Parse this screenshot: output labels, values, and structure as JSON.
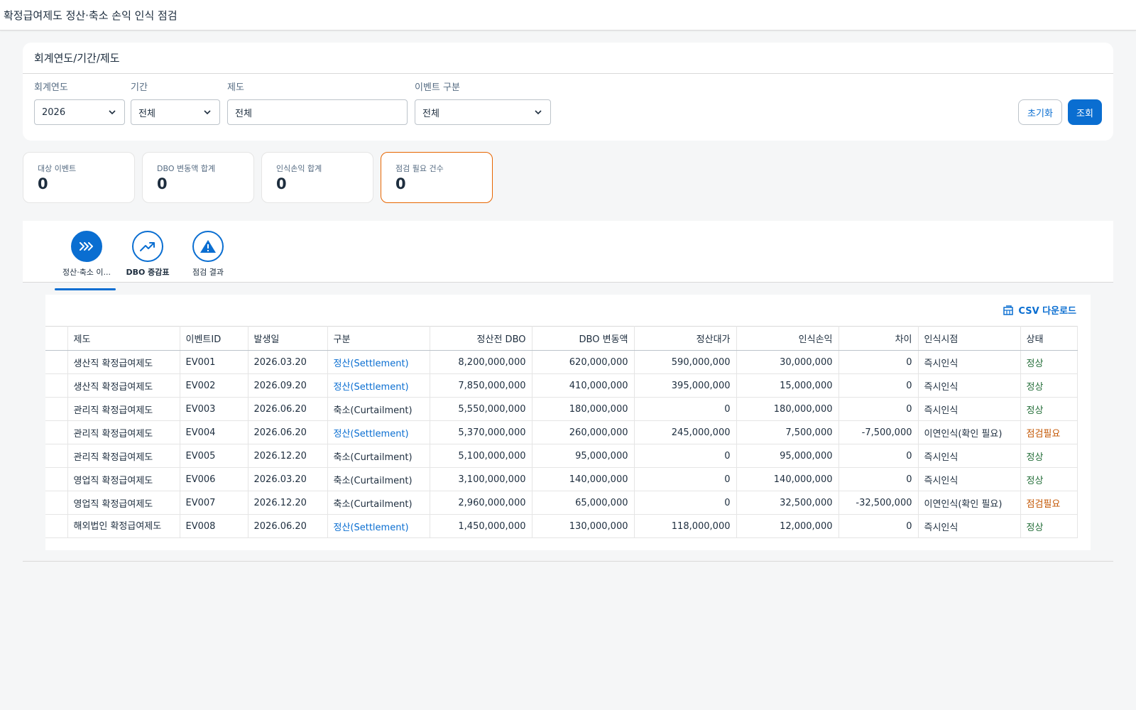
{
  "app": {
    "title": "확정급여제도 정산·축소 손익 인식 점검"
  },
  "filters": {
    "header": "회계연도/기간/제도",
    "fiscal_year": {
      "label": "회계연도",
      "value": "2026"
    },
    "period": {
      "label": "기간",
      "value": "전체"
    },
    "plan": {
      "label": "제도",
      "value": "전체"
    },
    "event_type": {
      "label": "이벤트 구분",
      "value": "전체"
    },
    "reset_label": "초기화",
    "search_label": "조회"
  },
  "kpis": [
    {
      "label": "대상 이벤트",
      "value": "0"
    },
    {
      "label": "DBO 변동액 합계",
      "value": "0"
    },
    {
      "label": "인식손익 합계",
      "value": "0"
    },
    {
      "label": "점검 필요 건수",
      "value": "0"
    }
  ],
  "tabs": [
    {
      "label": "정산·축소 이...",
      "icon": "forward-icon",
      "active": true
    },
    {
      "label": "DBO 증감표",
      "icon": "trend-up-icon",
      "active": false
    },
    {
      "label": "점검 결과",
      "icon": "warning-icon",
      "active": false
    }
  ],
  "table": {
    "csv_label": "CSV 다운로드",
    "columns": [
      "제도",
      "이벤트ID",
      "발생일",
      "구분",
      "정산전 DBO",
      "DBO 변동액",
      "정산대가",
      "인식손익",
      "차이",
      "인식시점",
      "상태"
    ],
    "rows": [
      [
        "생산직 확정급여제도",
        "EV001",
        "2026.03.20",
        "정산(Settlement)",
        "8,200,000,000",
        "620,000,000",
        "590,000,000",
        "30,000,000",
        "0",
        "즉시인식",
        "정상"
      ],
      [
        "생산직 확정급여제도",
        "EV002",
        "2026.09.20",
        "정산(Settlement)",
        "7,850,000,000",
        "410,000,000",
        "395,000,000",
        "15,000,000",
        "0",
        "즉시인식",
        "정상"
      ],
      [
        "관리직 확정급여제도",
        "EV003",
        "2026.06.20",
        "축소(Curtailment)",
        "5,550,000,000",
        "180,000,000",
        "0",
        "180,000,000",
        "0",
        "즉시인식",
        "정상"
      ],
      [
        "관리직 확정급여제도",
        "EV004",
        "2026.06.20",
        "정산(Settlement)",
        "5,370,000,000",
        "260,000,000",
        "245,000,000",
        "7,500,000",
        "-7,500,000",
        "이연인식(확인 필요)",
        "점검필요"
      ],
      [
        "관리직 확정급여제도",
        "EV005",
        "2026.12.20",
        "축소(Curtailment)",
        "5,100,000,000",
        "95,000,000",
        "0",
        "95,000,000",
        "0",
        "즉시인식",
        "정상"
      ],
      [
        "영업직 확정급여제도",
        "EV006",
        "2026.03.20",
        "축소(Curtailment)",
        "3,100,000,000",
        "140,000,000",
        "0",
        "140,000,000",
        "0",
        "즉시인식",
        "정상"
      ],
      [
        "영업직 확정급여제도",
        "EV007",
        "2026.12.20",
        "축소(Curtailment)",
        "2,960,000,000",
        "65,000,000",
        "0",
        "32,500,000",
        "-32,500,000",
        "이연인식(확인 필요)",
        "점검필요"
      ],
      [
        "해외법인 확정급여제도",
        "EV008",
        "2026.06.20",
        "정산(Settlement)",
        "1,450,000,000",
        "130,000,000",
        "118,000,000",
        "12,000,000",
        "0",
        "즉시인식",
        "정상"
      ]
    ]
  },
  "colors": {
    "accent": "#0a6ed1",
    "ok": "#256f3a",
    "warning": "#c35500"
  }
}
